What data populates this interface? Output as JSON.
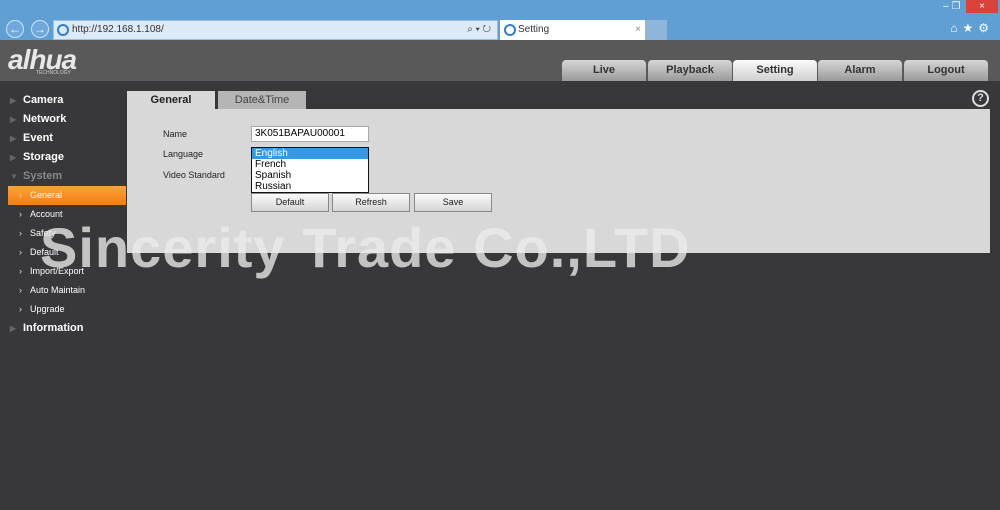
{
  "browser": {
    "url": "http://192.168.1.108/",
    "tab_title": "Setting",
    "tab_close": "×",
    "window_controls": [
      "–",
      "❐",
      "×"
    ],
    "icons": [
      "home-icon",
      "star-icon",
      "gear-icon"
    ]
  },
  "brand": {
    "logo": "alhua",
    "logo_sub": "TECHNOLOGY"
  },
  "main_tabs": [
    {
      "label": "Live"
    },
    {
      "label": "Playback"
    },
    {
      "label": "Setting",
      "active": true
    },
    {
      "label": "Alarm"
    },
    {
      "label": "Logout"
    }
  ],
  "help": "?",
  "sidebar": {
    "items": [
      {
        "label": "Camera"
      },
      {
        "label": "Network"
      },
      {
        "label": "Event"
      },
      {
        "label": "Storage"
      },
      {
        "label": "System",
        "expanded": true
      },
      {
        "label": "Information"
      }
    ],
    "system_sub": [
      {
        "label": "General",
        "active": true
      },
      {
        "label": "Account"
      },
      {
        "label": "Safety"
      },
      {
        "label": "Default"
      },
      {
        "label": "Import/Export"
      },
      {
        "label": "Auto Maintain"
      },
      {
        "label": "Upgrade"
      }
    ]
  },
  "panel": {
    "tabs": [
      {
        "label": "General",
        "active": true
      },
      {
        "label": "Date&Time"
      }
    ],
    "name_label": "Name",
    "name_value": "3K051BAPAU00001",
    "language_label": "Language",
    "language_options": [
      "English",
      "French",
      "Spanish",
      "Russian"
    ],
    "language_selected": "English",
    "video_label": "Video Standard",
    "buttons": {
      "default": "Default",
      "refresh": "Refresh",
      "save": "Save"
    }
  },
  "watermark": "Sincerity Trade Co.,LTD",
  "colors": {
    "accent": "#f08a1c",
    "selection": "#3399e0",
    "chrome": "#5f9fd3"
  }
}
